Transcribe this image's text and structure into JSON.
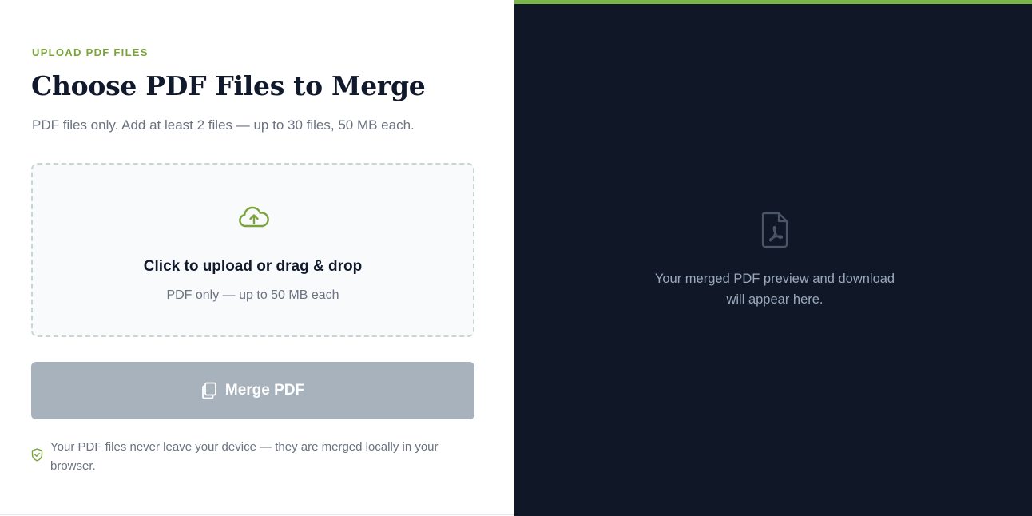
{
  "upload_panel": {
    "eyebrow": "UPLOAD PDF FILES",
    "title": "Choose PDF Files to Merge",
    "subtitle": "PDF files only. Add at least 2 files — up to 30 files, 50 MB each.",
    "dropzone": {
      "icon": "cloud-upload-icon",
      "title": "Click to upload or drag & drop",
      "subtitle": "PDF only — up to 50 MB each"
    },
    "merge_button": {
      "icon": "copy-files-icon",
      "label": "Merge PDF",
      "disabled": true
    },
    "privacy_note": {
      "icon": "shield-check-icon",
      "text": "Your PDF files never leave your device — they are merged locally in your browser."
    }
  },
  "preview_panel": {
    "icon": "pdf-file-icon",
    "placeholder": "Your merged PDF preview and download will appear here."
  },
  "colors": {
    "accent_green": "#7aa33a",
    "accent_bar": "#7ab648",
    "dark_panel": "#101828",
    "button_disabled": "#a8b2bd",
    "heading": "#111a2c",
    "muted_text": "#6b7280"
  }
}
